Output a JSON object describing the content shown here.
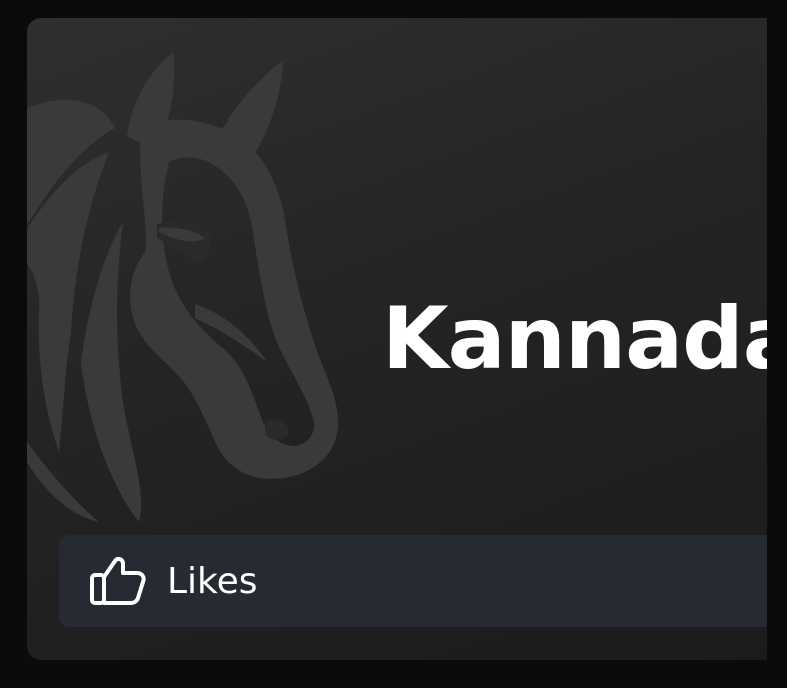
{
  "card": {
    "title": "Kannada",
    "logo_icon": "horse-head-icon",
    "likes": {
      "icon": "thumbs-up-icon",
      "label": "Likes"
    }
  },
  "colors": {
    "page_background": "#0b0b0b",
    "card_background": "#262626",
    "likes_bar_background": "#262a33",
    "title_text": "#ffffff",
    "logo_overlay": "#3a3a3a"
  }
}
